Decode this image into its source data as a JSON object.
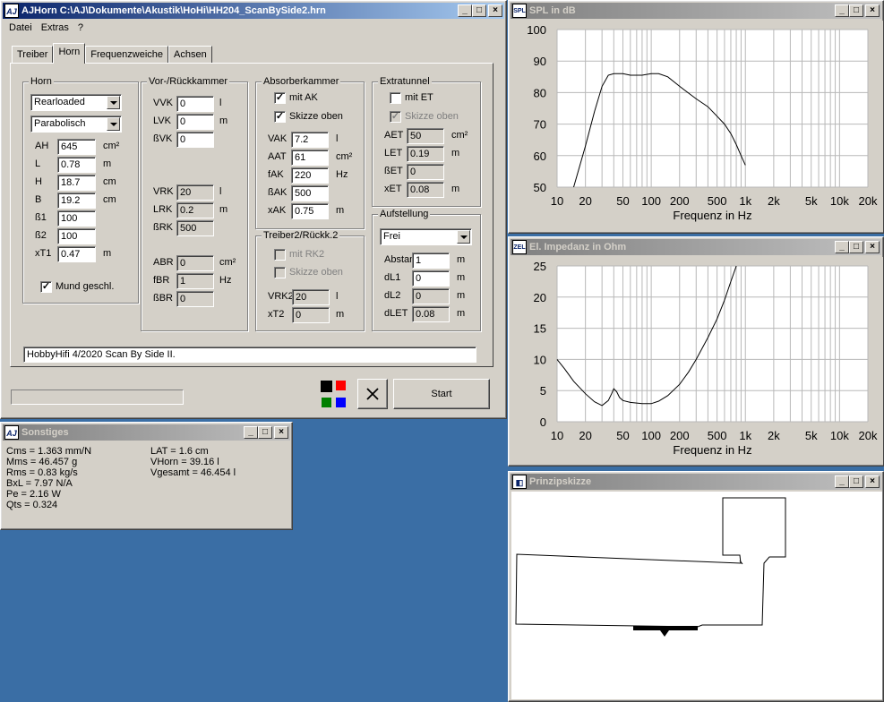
{
  "main": {
    "title": "AJHorn  C:\\AJ\\Dokumente\\Akustik\\HoHi\\HH204_ScanBySide2.hrn",
    "icon": "AJ",
    "menu": [
      "Datei",
      "Extras",
      "?"
    ],
    "tabs": [
      "Treiber",
      "Horn",
      "Frequenzweiche",
      "Achsen"
    ],
    "horn": {
      "label": "Horn",
      "type": "Rearloaded",
      "shape": "Parabolisch",
      "rows": [
        {
          "label": "AH",
          "value": "645",
          "unit": "cm²"
        },
        {
          "label": "L",
          "value": "0.78",
          "unit": "m"
        },
        {
          "label": "H",
          "value": "18.7",
          "unit": "cm"
        },
        {
          "label": "B",
          "value": "19.2",
          "unit": "cm"
        },
        {
          "label": "ß1",
          "value": "100",
          "unit": ""
        },
        {
          "label": "ß2",
          "value": "100",
          "unit": ""
        },
        {
          "label": "xT1",
          "value": "0.47",
          "unit": "m"
        }
      ],
      "mund": "Mund geschl."
    },
    "vor": {
      "label": "Vor-/Rückkammer",
      "rows1": [
        {
          "label": "VVK",
          "value": "0",
          "unit": "l"
        },
        {
          "label": "LVK",
          "value": "0",
          "unit": "m"
        },
        {
          "label": "ßVK",
          "value": "0",
          "unit": ""
        }
      ],
      "rows2": [
        {
          "label": "VRK",
          "value": "20",
          "unit": "l"
        },
        {
          "label": "LRK",
          "value": "0.2",
          "unit": "m"
        },
        {
          "label": "ßRK",
          "value": "500",
          "unit": ""
        }
      ],
      "rows3": [
        {
          "label": "ABR",
          "value": "0",
          "unit": "cm²"
        },
        {
          "label": "fBR",
          "value": "1",
          "unit": "Hz"
        },
        {
          "label": "ßBR",
          "value": "0",
          "unit": ""
        }
      ]
    },
    "absorber": {
      "label": "Absorberkammer",
      "mit": "mit AK",
      "skizze": "Skizze oben",
      "rows": [
        {
          "label": "VAK",
          "value": "7.2",
          "unit": "l"
        },
        {
          "label": "AAT",
          "value": "61",
          "unit": "cm²"
        },
        {
          "label": "fAK",
          "value": "220",
          "unit": "Hz"
        },
        {
          "label": "ßAK",
          "value": "500",
          "unit": ""
        },
        {
          "label": "xAK",
          "value": "0.75",
          "unit": "m"
        }
      ]
    },
    "treiber2": {
      "label": "Treiber2/Rückk.2",
      "mit": "mit RK2",
      "skizze": "Skizze oben",
      "rows": [
        {
          "label": "VRK2",
          "value": "20",
          "unit": "l"
        },
        {
          "label": "xT2",
          "value": "0",
          "unit": "m"
        }
      ]
    },
    "extra": {
      "label": "Extratunnel",
      "mit": "mit ET",
      "skizze": "Skizze oben",
      "rows": [
        {
          "label": "AET",
          "value": "50",
          "unit": "cm²"
        },
        {
          "label": "LET",
          "value": "0.19",
          "unit": "m"
        },
        {
          "label": "ßET",
          "value": "0",
          "unit": ""
        },
        {
          "label": "xET",
          "value": "0.08",
          "unit": "m"
        }
      ]
    },
    "aufstellung": {
      "label": "Aufstellung",
      "mode": "Frei",
      "rows": [
        {
          "label": "Abstand",
          "value": "1",
          "unit": "m"
        },
        {
          "label": "dL1",
          "value": "0",
          "unit": "m"
        },
        {
          "label": "dL2",
          "value": "0",
          "unit": "m"
        },
        {
          "label": "dLET",
          "value": "0.08",
          "unit": "m"
        }
      ]
    },
    "comment": "HobbyHifi 4/2020 Scan By Side II.",
    "start": "Start",
    "cancel_icon": "close-icon",
    "colors": {
      "black": "#000000",
      "red": "#ff0000",
      "green": "#008000",
      "blue": "#0000ff"
    }
  },
  "sonstiges": {
    "title": "Sonstiges",
    "icon": "AJ",
    "col1": [
      "Cms = 1.363 mm/N",
      "Mms = 46.457 g",
      "Rms = 0.83 kg/s",
      "BxL = 7.97 N/A",
      "Pe = 2.16 W",
      "Qts = 0.324"
    ],
    "col2": [
      "LAT = 1.6 cm",
      "VHorn = 39.16 l",
      "Vgesamt = 46.454 l"
    ]
  },
  "spl": {
    "title": "SPL in dB",
    "icon": "SPL"
  },
  "impedance": {
    "title": "El. Impedanz in Ohm",
    "icon": "ZEL"
  },
  "skizze": {
    "title": "Prinzipskizze",
    "icon": "speaker-icon"
  },
  "chart_data": [
    {
      "type": "line",
      "title": "SPL in dB",
      "xlabel": "Frequenz in Hz",
      "ylabel": "",
      "xscale": "log",
      "xlim": [
        10,
        20000
      ],
      "ylim": [
        50,
        100
      ],
      "xticks": [
        "10",
        "20",
        "50",
        "100",
        "200",
        "500",
        "1k",
        "2k",
        "5k",
        "10k",
        "20k"
      ],
      "xtick_values": [
        10,
        20,
        50,
        100,
        200,
        500,
        1000,
        2000,
        5000,
        10000,
        20000
      ],
      "yticks": [
        "100",
        "90",
        "80",
        "70",
        "60",
        "50"
      ],
      "ytick_values": [
        100,
        90,
        80,
        70,
        60,
        50
      ],
      "grid": true,
      "x": [
        15,
        20,
        25,
        30,
        35,
        40,
        50,
        60,
        80,
        100,
        120,
        150,
        200,
        300,
        400,
        500,
        600,
        700,
        800,
        900,
        1000
      ],
      "y": [
        50,
        63,
        74,
        82,
        85.5,
        86,
        86,
        85.5,
        85.5,
        86,
        86,
        85,
        82,
        78,
        75.5,
        72.5,
        70,
        67,
        63.5,
        60,
        57
      ]
    },
    {
      "type": "line",
      "title": "El. Impedanz in Ohm",
      "xlabel": "Frequenz in Hz",
      "ylabel": "",
      "xscale": "log",
      "xlim": [
        10,
        20000
      ],
      "ylim": [
        0,
        25
      ],
      "xticks": [
        "10",
        "20",
        "50",
        "100",
        "200",
        "500",
        "1k",
        "2k",
        "5k",
        "10k",
        "20k"
      ],
      "xtick_values": [
        10,
        20,
        50,
        100,
        200,
        500,
        1000,
        2000,
        5000,
        10000,
        20000
      ],
      "yticks": [
        "25",
        "20",
        "15",
        "10",
        "5",
        "0"
      ],
      "ytick_values": [
        25,
        20,
        15,
        10,
        5,
        0
      ],
      "grid": true,
      "x": [
        10,
        12,
        15,
        20,
        25,
        30,
        35,
        38,
        40,
        43,
        46,
        50,
        60,
        70,
        80,
        100,
        120,
        150,
        200,
        250,
        300,
        400,
        500,
        600,
        700,
        800
      ],
      "y": [
        10,
        8.5,
        6.5,
        4.5,
        3.2,
        2.6,
        3.4,
        4.5,
        5.3,
        4.8,
        3.9,
        3.4,
        3.1,
        3.0,
        2.9,
        2.9,
        3.3,
        4.2,
        6,
        8,
        10,
        13.5,
        16.5,
        19.5,
        22.5,
        25
      ]
    }
  ]
}
